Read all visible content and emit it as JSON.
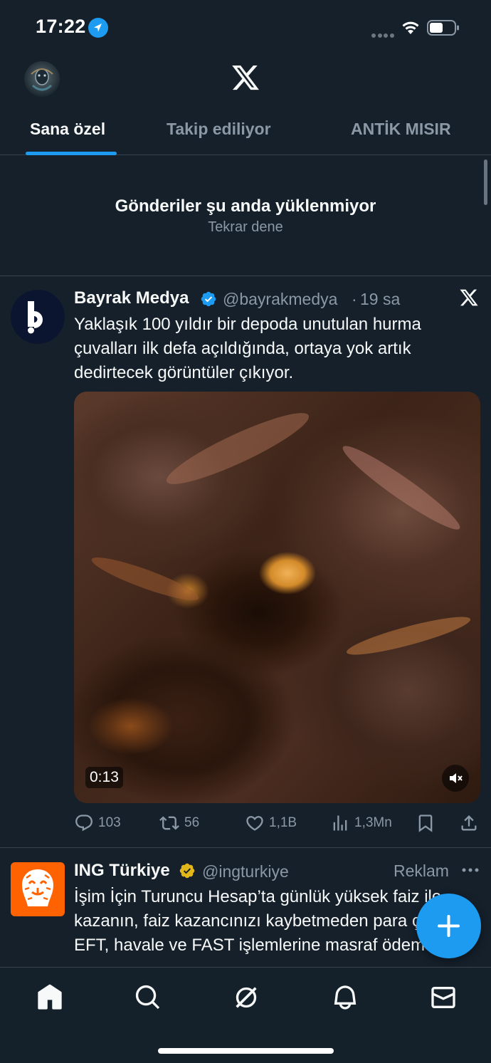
{
  "status_bar": {
    "time": "17:22",
    "icons": [
      "location-arrow-icon",
      "cellular-signal-icon",
      "wifi-icon",
      "battery-icon"
    ]
  },
  "header": {
    "logo": "x-logo-icon"
  },
  "tabs": [
    {
      "label": "Sana özel",
      "active": true
    },
    {
      "label": "Takip ediliyor",
      "active": false
    },
    {
      "label": "ANTİK MISIR",
      "active": false
    }
  ],
  "notice": {
    "title": "Gönderiler şu anda yüklenmiyor",
    "retry": "Tekrar dene"
  },
  "tweets": [
    {
      "name": "Bayrak Medya",
      "handle": "@bayrakmedya",
      "separator": "·",
      "time": "19 sa",
      "text": "Yaklaşık 100 yıldır bir depoda unutulan hurma çuvalları ilk defa açıldığında, ortaya yok artık dedirtecek görüntüler çıkıyor.",
      "video_duration": "0:13",
      "stats": {
        "replies": "103",
        "retweets": "56",
        "likes": "1,1B",
        "views": "1,3Mn"
      }
    },
    {
      "name": "ING Türkiye",
      "handle": "@ingturkiye",
      "label": "Reklam",
      "text": "İşim İçin Turuncu Hesap’ta günlük yüksek faiz ile kazanın, faiz kazancınızı kaybetmeden para çekin. EFT, havale ve FAST işlemlerine masraf ödemeyin."
    }
  ],
  "colors": {
    "background": "#15202b",
    "accent": "#1d9bf0",
    "muted_text": "#8b98a5",
    "divider": "#38444d",
    "verified_gold": "#e2b719",
    "ing_orange": "#ff6200"
  },
  "bottom_nav": [
    "home-icon",
    "search-icon",
    "grok-icon",
    "notifications-icon",
    "messages-icon"
  ]
}
